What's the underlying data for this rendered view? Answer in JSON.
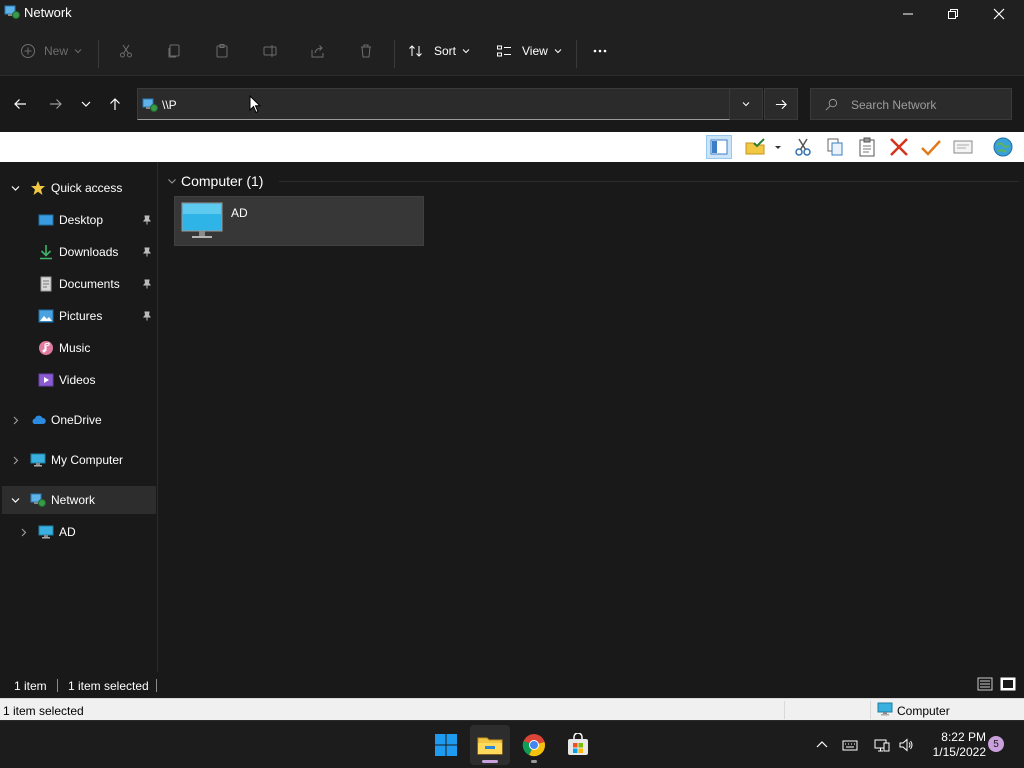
{
  "window": {
    "title": "Network",
    "minimize_icon": "minimize-icon",
    "maximize_icon": "restore-icon",
    "close_icon": "close-icon"
  },
  "commandbar": {
    "new_label": "New",
    "sort_label": "Sort",
    "view_label": "View",
    "more_icon": "more-icon",
    "disabled_actions": [
      "cut-icon",
      "copy-icon",
      "paste-icon",
      "rename-icon",
      "share-icon",
      "delete-icon"
    ]
  },
  "address": {
    "value": "\\\\P",
    "search_placeholder": "Search Network"
  },
  "legacy_toolbar": {
    "icons": [
      "preview-pane-icon",
      "folder-check-icon",
      "dropdown-icon",
      "cut-icon",
      "copy-icon",
      "paste-icon",
      "delete-icon",
      "check-icon",
      "properties-icon",
      "globe-icon"
    ]
  },
  "sidebar": {
    "quick_access": "Quick access",
    "items": [
      {
        "label": "Desktop",
        "icon": "desktop-icon",
        "pinned": true
      },
      {
        "label": "Downloads",
        "icon": "downloads-icon",
        "pinned": true
      },
      {
        "label": "Documents",
        "icon": "documents-icon",
        "pinned": true
      },
      {
        "label": "Pictures",
        "icon": "pictures-icon",
        "pinned": true
      },
      {
        "label": "Music",
        "icon": "music-icon",
        "pinned": false
      },
      {
        "label": "Videos",
        "icon": "videos-icon",
        "pinned": false
      }
    ],
    "onedrive": "OneDrive",
    "my_computer": "My Computer",
    "network": "Network",
    "network_child": "AD"
  },
  "content": {
    "group_header": "Computer (1)",
    "items": [
      {
        "name": "AD",
        "icon": "computer-icon"
      }
    ]
  },
  "status": {
    "item_count": "1 item",
    "selected": "1 item selected",
    "legacy_selected": "1 item selected",
    "legacy_zone": "Computer"
  },
  "taskbar": {
    "apps": [
      "windows-start-icon",
      "file-explorer-icon",
      "chrome-icon",
      "store-icon"
    ],
    "time": "8:22 PM",
    "date": "1/15/2022",
    "notification_count": "5"
  },
  "colors": {
    "accent": "#0078d4",
    "folder_yellow": "#f2c744",
    "background": "#191919"
  }
}
